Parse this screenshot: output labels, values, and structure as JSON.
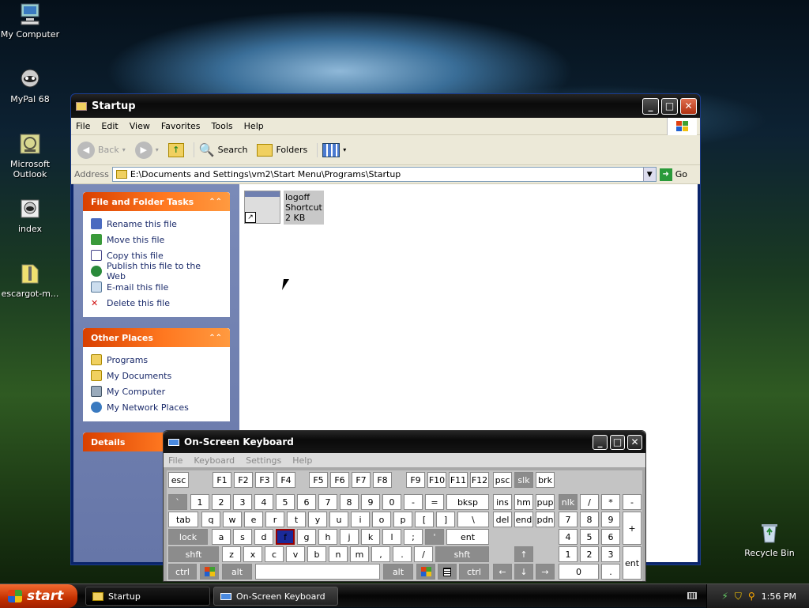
{
  "desktop": {
    "icons": [
      {
        "label": "My Computer"
      },
      {
        "label": "MyPal 68"
      },
      {
        "label": "Microsoft Outlook"
      },
      {
        "label": "index"
      },
      {
        "label": "escargot-m..."
      },
      {
        "label": "Recycle Bin"
      }
    ]
  },
  "explorer": {
    "title": "Startup",
    "menu": [
      "File",
      "Edit",
      "View",
      "Favorites",
      "Tools",
      "Help"
    ],
    "toolbar": {
      "back": "Back",
      "search": "Search",
      "folders": "Folders"
    },
    "address": {
      "label": "Address",
      "value": "E:\\Documents and Settings\\vm2\\Start Menu\\Programs\\Startup",
      "go": "Go"
    },
    "tasks": {
      "title": "File and Folder Tasks",
      "items": [
        "Rename this file",
        "Move this file",
        "Copy this file",
        "Publish this file to the Web",
        "E-mail this file",
        "Delete this file"
      ]
    },
    "places": {
      "title": "Other Places",
      "items": [
        "Programs",
        "My Documents",
        "My Computer",
        "My Network Places"
      ]
    },
    "details": {
      "title": "Details"
    },
    "file": {
      "name": "logoff",
      "type": "Shortcut",
      "size": "2 KB"
    }
  },
  "osk": {
    "title": "On-Screen Keyboard",
    "menu": [
      "File",
      "Keyboard",
      "Settings",
      "Help"
    ],
    "keys": {
      "esc": "esc",
      "f1": "F1",
      "f2": "F2",
      "f3": "F3",
      "f4": "F4",
      "f5": "F5",
      "f6": "F6",
      "f7": "F7",
      "f8": "F8",
      "f9": "F9",
      "f10": "F10",
      "f11": "F11",
      "f12": "F12",
      "psc": "psc",
      "slk": "slk",
      "brk": "brk",
      "grave": "`",
      "n1": "1",
      "n2": "2",
      "n3": "3",
      "n4": "4",
      "n5": "5",
      "n6": "6",
      "n7": "7",
      "n8": "8",
      "n9": "9",
      "n0": "0",
      "minus": "-",
      "equal": "=",
      "bksp": "bksp",
      "ins": "ins",
      "hm": "hm",
      "pup": "pup",
      "nlk": "nlk",
      "div": "/",
      "mul": "*",
      "sub": "-",
      "tab": "tab",
      "q": "q",
      "w": "w",
      "e": "e",
      "r": "r",
      "t": "t",
      "y": "y",
      "u": "u",
      "i": "i",
      "o": "o",
      "p": "p",
      "lb": "[",
      "rb": "]",
      "bs": "\\",
      "del": "del",
      "end": "end",
      "pdn": "pdn",
      "p7": "7",
      "p8": "8",
      "p9": "9",
      "add": "+",
      "lock": "lock",
      "a": "a",
      "s": "s",
      "d": "d",
      "f": "f",
      "g": "g",
      "h": "h",
      "j": "j",
      "k": "k",
      "l": "l",
      "semi": ";",
      "quote": "'",
      "ent": "ent",
      "p4": "4",
      "p5": "5",
      "p6": "6",
      "shft": "shft",
      "z": "z",
      "x": "x",
      "c": "c",
      "v": "v",
      "b": "b",
      "n": "n",
      "m": "m",
      "comma": ",",
      "dot": ".",
      "slash": "/",
      "shft2": "shft",
      "up": "↑",
      "p1": "1",
      "p2": "2",
      "p3": "3",
      "pent": "ent",
      "ctrl": "ctrl",
      "alt": "alt",
      "alt2": "alt",
      "ctrl2": "ctrl",
      "left": "←",
      "down": "↓",
      "right": "→",
      "p0": "0",
      "pdot": "."
    }
  },
  "taskbar": {
    "start": "start",
    "tasks": [
      "Startup",
      "On-Screen Keyboard"
    ],
    "time": "1:56 PM"
  },
  "colors": {
    "titlebar": "#111111",
    "taskpane_header": "#ff7820",
    "taskpane_bg": "#7080b0",
    "start": "#e05010"
  }
}
